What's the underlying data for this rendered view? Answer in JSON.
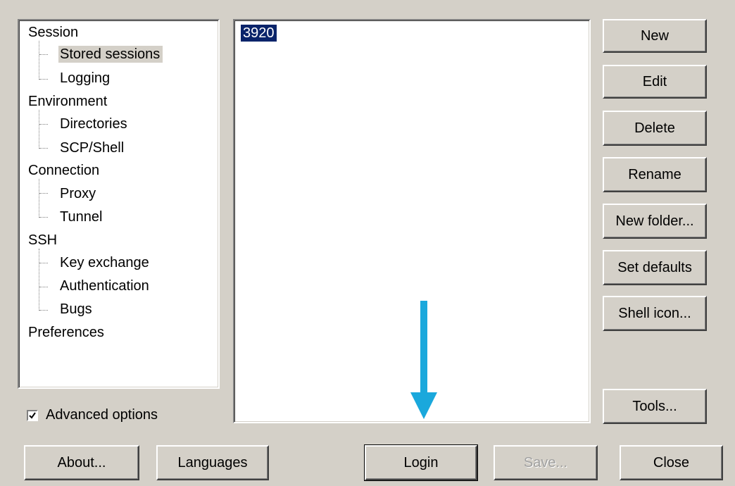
{
  "tree": {
    "items": [
      {
        "label": "Session",
        "level": 0
      },
      {
        "label": "Stored sessions",
        "level": 1,
        "selected": true
      },
      {
        "label": "Logging",
        "level": 1
      },
      {
        "label": "Environment",
        "level": 0
      },
      {
        "label": "Directories",
        "level": 1
      },
      {
        "label": "SCP/Shell",
        "level": 1
      },
      {
        "label": "Connection",
        "level": 0
      },
      {
        "label": "Proxy",
        "level": 1
      },
      {
        "label": "Tunnel",
        "level": 1
      },
      {
        "label": "SSH",
        "level": 0
      },
      {
        "label": "Key exchange",
        "level": 1
      },
      {
        "label": "Authentication",
        "level": 1
      },
      {
        "label": "Bugs",
        "level": 1
      },
      {
        "label": "Preferences",
        "level": 0
      }
    ]
  },
  "sessions": {
    "items": [
      {
        "label": "3920",
        "selected": true
      }
    ]
  },
  "side_buttons": {
    "new": "New",
    "edit": "Edit",
    "delete": "Delete",
    "rename": "Rename",
    "new_folder": "New folder...",
    "set_defaults": "Set defaults",
    "shell_icon": "Shell icon...",
    "tools": "Tools..."
  },
  "options": {
    "advanced_label": "Advanced options",
    "advanced_checked": true
  },
  "bottom_buttons": {
    "about": "About...",
    "languages": "Languages",
    "login": "Login",
    "save": "Save...",
    "close": "Close"
  },
  "colors": {
    "arrow": "#1aa8dc",
    "selection": "#0a246a",
    "face": "#d4d0c8"
  },
  "annotations": {
    "arrow_icon": "down-arrow-icon"
  }
}
